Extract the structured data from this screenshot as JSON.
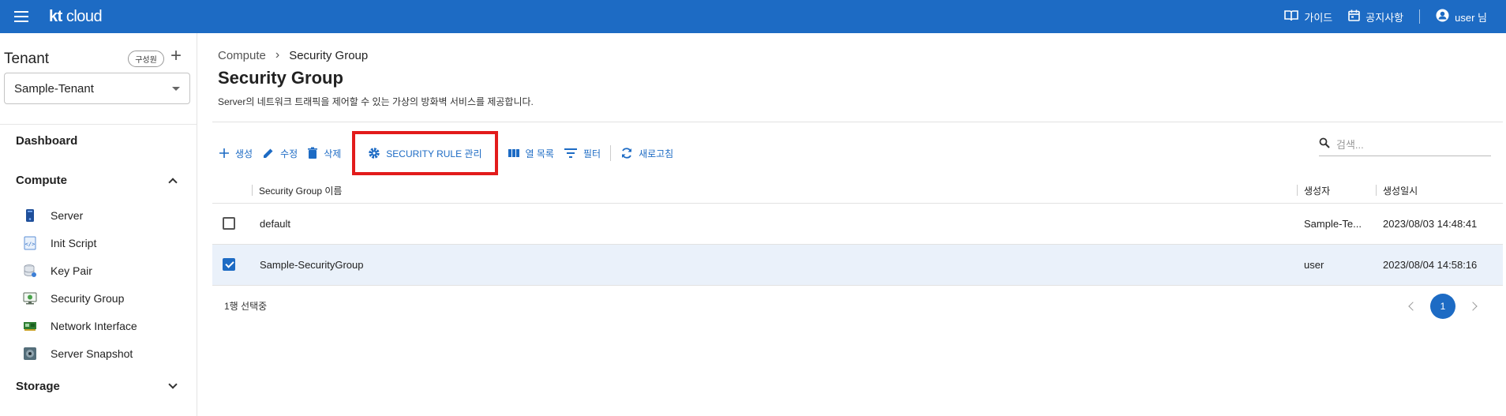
{
  "header": {
    "logo_kt": "kt",
    "logo_cloud": "cloud",
    "guide": "가이드",
    "notice": "공지사항",
    "user": "user 님"
  },
  "sidebar": {
    "tenant_title": "Tenant",
    "member_button": "구성원",
    "tenant_selected": "Sample-Tenant",
    "dashboard": "Dashboard",
    "compute": "Compute",
    "items": [
      {
        "label": "Server",
        "icon": "server-icon"
      },
      {
        "label": "Init Script",
        "icon": "script-icon"
      },
      {
        "label": "Key Pair",
        "icon": "key-pair-icon"
      },
      {
        "label": "Security Group",
        "icon": "security-group-icon"
      },
      {
        "label": "Network Interface",
        "icon": "network-interface-icon"
      },
      {
        "label": "Server Snapshot",
        "icon": "snapshot-icon"
      }
    ],
    "storage": "Storage"
  },
  "main": {
    "breadcrumb": [
      "Compute",
      "Security Group"
    ],
    "title": "Security Group",
    "description": "Server의 네트워크 트래픽을 제어할 수 있는 가상의 방화벽 서비스를 제공합니다.",
    "toolbar": {
      "create": "생성",
      "edit": "수정",
      "delete": "삭제",
      "security_rule": "SECURITY RULE 관리",
      "columns": "열 목록",
      "filter": "필터",
      "refresh": "새로고침"
    },
    "search_placeholder": "검색...",
    "table": {
      "columns": [
        "Security Group 이름",
        "생성자",
        "생성일시"
      ],
      "rows": [
        {
          "name": "default",
          "creator": "Sample-Te...",
          "created": "2023/08/03 14:48:41",
          "checked": false
        },
        {
          "name": "Sample-SecurityGroup",
          "creator": "user",
          "created": "2023/08/04 14:58:16",
          "checked": true
        }
      ]
    },
    "selection_count": "1행 선택중",
    "page": "1"
  },
  "colors": {
    "brand": "#1d6bc4",
    "highlight": "#e21b1b",
    "selected_row": "#eaf1fa"
  }
}
